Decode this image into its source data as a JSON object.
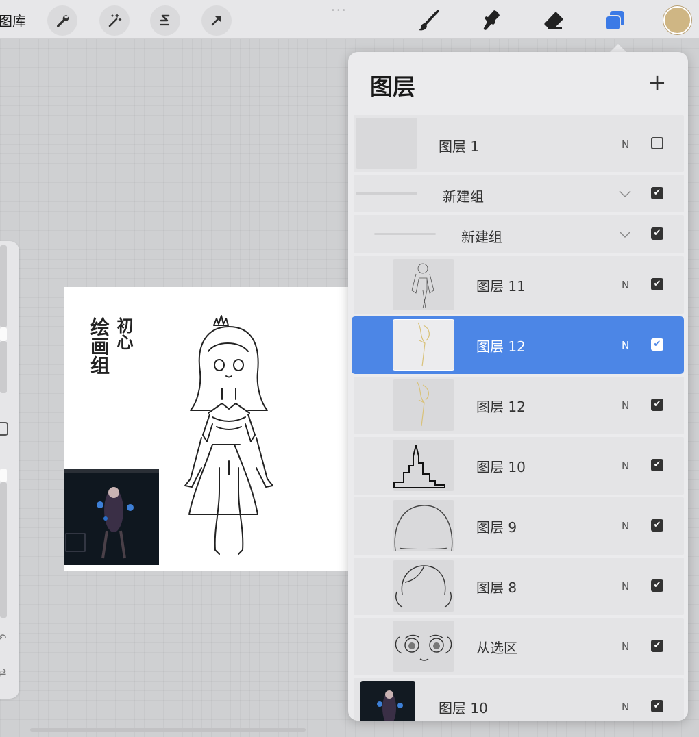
{
  "toolbar": {
    "gallery_label": "图库",
    "tools": [
      "wrench-icon",
      "magic-wand-icon",
      "selection-icon",
      "transform-arrow-icon"
    ],
    "right_tools": [
      "brush-icon",
      "smudge-icon",
      "eraser-icon",
      "layers-icon"
    ],
    "current_color": "#cfb684",
    "accent_color": "#3b7ae6"
  },
  "canvas": {
    "calligraphy": [
      "初心",
      "绘画组"
    ]
  },
  "layers_panel": {
    "title": "图层",
    "add_label": "+",
    "rows": [
      {
        "name": "图层 1",
        "blend": "N",
        "visible": false
      },
      {
        "name": "新建组",
        "type": "group",
        "visible": true
      },
      {
        "name": "新建组",
        "type": "group",
        "visible": true
      },
      {
        "name": "图层 11",
        "blend": "N",
        "visible": true
      },
      {
        "name": "图层 12",
        "blend": "N",
        "visible": true,
        "selected": true
      },
      {
        "name": "图层 12",
        "blend": "N",
        "visible": true
      },
      {
        "name": "图层 10",
        "blend": "N",
        "visible": true
      },
      {
        "name": "图层 9",
        "blend": "N",
        "visible": true
      },
      {
        "name": "图层 8",
        "blend": "N",
        "visible": true
      },
      {
        "name": "从选区",
        "blend": "N",
        "visible": true
      },
      {
        "name": "图层 10",
        "blend": "N",
        "visible": true
      }
    ]
  }
}
